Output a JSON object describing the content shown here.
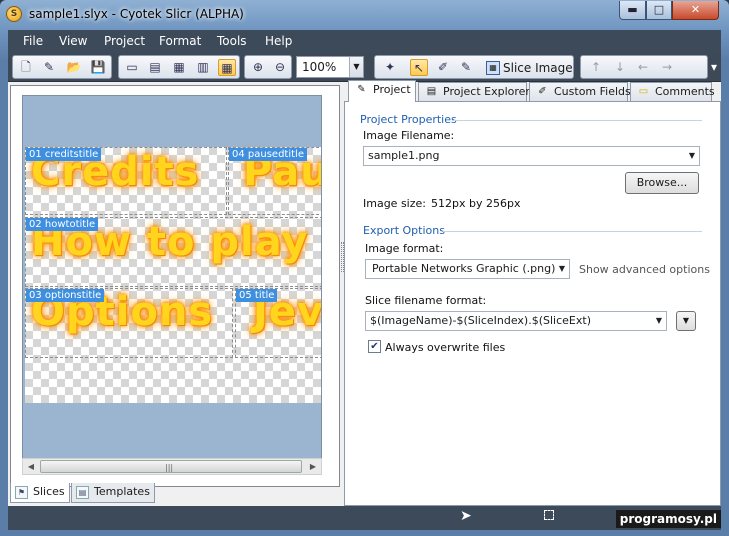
{
  "window": {
    "title": "sample1.slyx - Cyotek Slicr (ALPHA)",
    "app_icon_glyph": "S",
    "minimize_glyph": "▬",
    "maximize_glyph": "□",
    "close_glyph": "✕"
  },
  "menu": [
    {
      "label": "File"
    },
    {
      "label": "View"
    },
    {
      "label": "Project"
    },
    {
      "label": "Format"
    },
    {
      "label": "Tools"
    },
    {
      "label": "Help"
    }
  ],
  "toolbar": {
    "zoom_value": "100%",
    "slice_image_label": "Slice Image",
    "icons": {
      "new": "🗋",
      "edit": "✎",
      "open": "📂",
      "save": "💾",
      "view1": "▭",
      "view2": "▤",
      "view3": "▦",
      "view4": "▥",
      "grid": "▦",
      "zoom_in": "⊕",
      "zoom_out": "⊖",
      "wand": "✦",
      "pointer": "↖",
      "pencil": "✐",
      "brush": "✎",
      "up": "↑",
      "down": "↓",
      "left": "←",
      "right": "→",
      "overflow": "▾"
    }
  },
  "canvas": {
    "slices": [
      {
        "label": "01 creditstitle",
        "text": "Credits"
      },
      {
        "label": "04 pausedtitle",
        "text": "Pau"
      },
      {
        "label": "02 howtotitle",
        "text": "How to play"
      },
      {
        "label": "03 optionstitle",
        "text": "Options"
      },
      {
        "label": "05 title",
        "text": "Jev"
      }
    ]
  },
  "left_tabs": [
    {
      "label": "Slices",
      "icon": "⚑"
    },
    {
      "label": "Templates",
      "icon": "▤"
    }
  ],
  "right_tabs": [
    {
      "label": "Project",
      "icon": "✎"
    },
    {
      "label": "Project Explorer",
      "icon": "▤"
    },
    {
      "label": "Custom Fields",
      "icon": "✐"
    },
    {
      "label": "Comments",
      "icon": "▭"
    }
  ],
  "project": {
    "properties_heading": "Project Properties",
    "image_filename_label": "Image Filename:",
    "image_filename_value": "sample1.png",
    "browse_label": "Browse...",
    "image_size_label": "Image size:",
    "image_size_value": "512px by 256px",
    "export_heading": "Export Options",
    "image_format_label": "Image format:",
    "image_format_value": "Portable Networks Graphic (.png)",
    "show_advanced_label": "Show advanced options",
    "slice_filename_label": "Slice filename format:",
    "slice_filename_value": "$(ImageName)-$(SliceIndex).$(SliceExt)",
    "overwrite_label": "Always overwrite files",
    "overwrite_checked": true
  },
  "statusbar": {
    "watermark": "programosy.pl"
  }
}
